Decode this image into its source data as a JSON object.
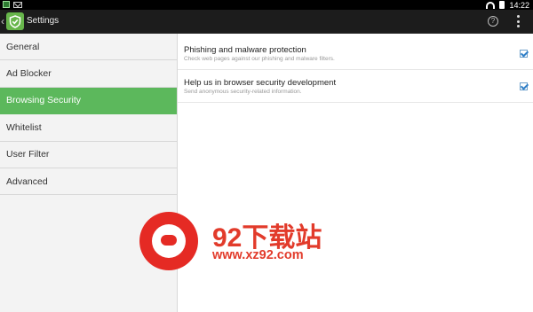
{
  "status_bar": {
    "time": "14:22",
    "icons": [
      "image-notification-icon",
      "mail-icon",
      "wifi-icon",
      "battery-icon"
    ]
  },
  "action_bar": {
    "title": "Settings",
    "help_glyph": "?",
    "icons": [
      "up-arrow-icon",
      "app-shield-icon",
      "help-icon",
      "overflow-menu-icon"
    ]
  },
  "sidebar": {
    "items": [
      {
        "label": "General"
      },
      {
        "label": "Ad Blocker"
      },
      {
        "label": "Browsing Security",
        "active": true
      },
      {
        "label": "Whitelist"
      },
      {
        "label": "User Filter"
      },
      {
        "label": "Advanced"
      }
    ]
  },
  "preferences": [
    {
      "title": "Phishing and malware protection",
      "summary": "Check web pages against our phishing and malware filters.",
      "checked": true
    },
    {
      "title": "Help us in browser security development",
      "summary": "Send anonymous security-related information.",
      "checked": true
    }
  ],
  "watermark": {
    "name": "92下载站",
    "url": "www.xz92.com"
  },
  "colors": {
    "accent_green": "#5cb85c",
    "action_bar": "#1c1c1c",
    "checkbox_blue": "#2f7fc8",
    "watermark_red": "#e23b2b"
  }
}
